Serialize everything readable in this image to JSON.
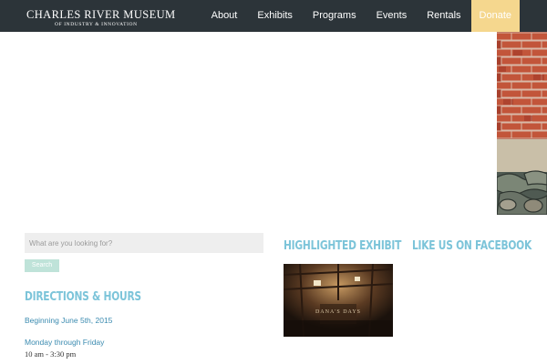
{
  "brand": {
    "title": "CHARLES RIVER MUSEUM",
    "subtitle": "OF INDUSTRY & INNOVATION"
  },
  "nav": {
    "items": [
      {
        "label": "About"
      },
      {
        "label": "Exhibits"
      },
      {
        "label": "Programs"
      },
      {
        "label": "Events"
      },
      {
        "label": "Rentals"
      },
      {
        "label": "Donate"
      }
    ]
  },
  "search": {
    "placeholder": "What are you looking for?",
    "button_label": "Search"
  },
  "directions": {
    "heading": "DIRECTIONS & HOURS",
    "date_text": "Beginning June 5th, 2015",
    "days_text": "Monday through Friday",
    "hours_text": "10 am - 3:30 pm"
  },
  "exhibit": {
    "heading": "HIGHLIGHTED EXHIBIT",
    "photo_caption": "DANA'S DAYS"
  },
  "facebook": {
    "heading": "LIKE US ON FACEBOOK"
  },
  "colors": {
    "topbar": "#2c3439",
    "donate": "#f5d78e",
    "heading_accent": "#7cc4d9",
    "link_blue": "#3b8bb0",
    "search_button": "#bfe3d9"
  },
  "icons": {
    "wall": "brick-stone-wall-image",
    "exhibit": "exhibit-photo-image"
  }
}
